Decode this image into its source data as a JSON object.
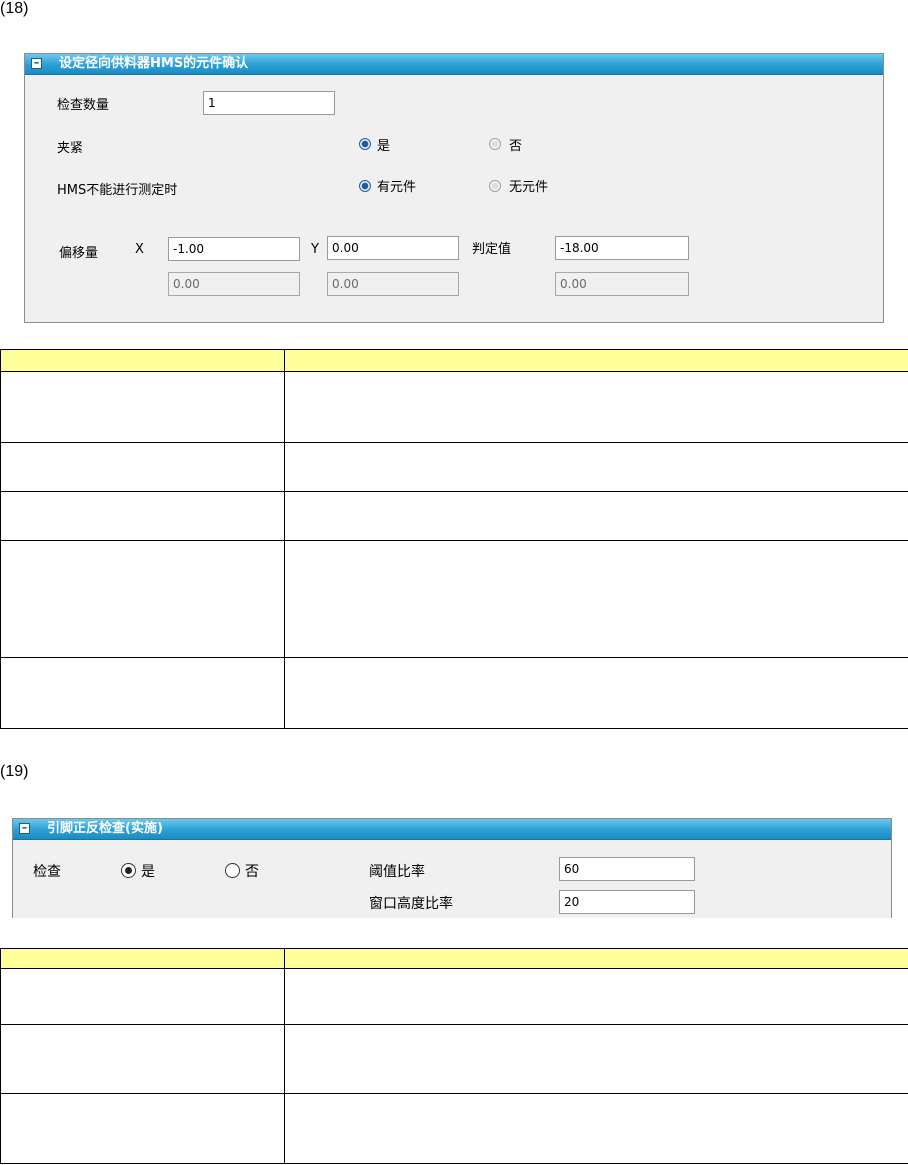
{
  "section18": {
    "number": "(18)",
    "panel_title": "设定径向供料器HMS的元件确认",
    "collapse_symbol": "–",
    "check_count": {
      "label": "检查数量",
      "value": "1"
    },
    "clamp": {
      "label": "夹紧",
      "options": [
        "是",
        "否"
      ],
      "selected": "是"
    },
    "hms_unmeasurable": {
      "label": "HMS不能进行测定时",
      "options": [
        "有元件",
        "无元件"
      ],
      "selected": "有元件"
    },
    "offset": {
      "label": "偏移量",
      "x_label": "X",
      "y_label": "Y",
      "judge_label": "判定值",
      "x_value": "-1.00",
      "y_value": "0.00",
      "judge_value": "-18.00",
      "x_readonly": "0.00",
      "y_readonly": "0.00",
      "judge_readonly": "0.00"
    },
    "table_rows": 6
  },
  "section19": {
    "number": "(19)",
    "panel_title": "引脚正反检查(实施)",
    "collapse_symbol": "–",
    "check": {
      "label": "检查",
      "options": [
        "是",
        "否"
      ],
      "selected": "是"
    },
    "threshold_ratio": {
      "label": "阈值比率",
      "value": "60"
    },
    "window_height_ratio": {
      "label": "窗口高度比率",
      "value": "20"
    },
    "table_rows": 4
  }
}
